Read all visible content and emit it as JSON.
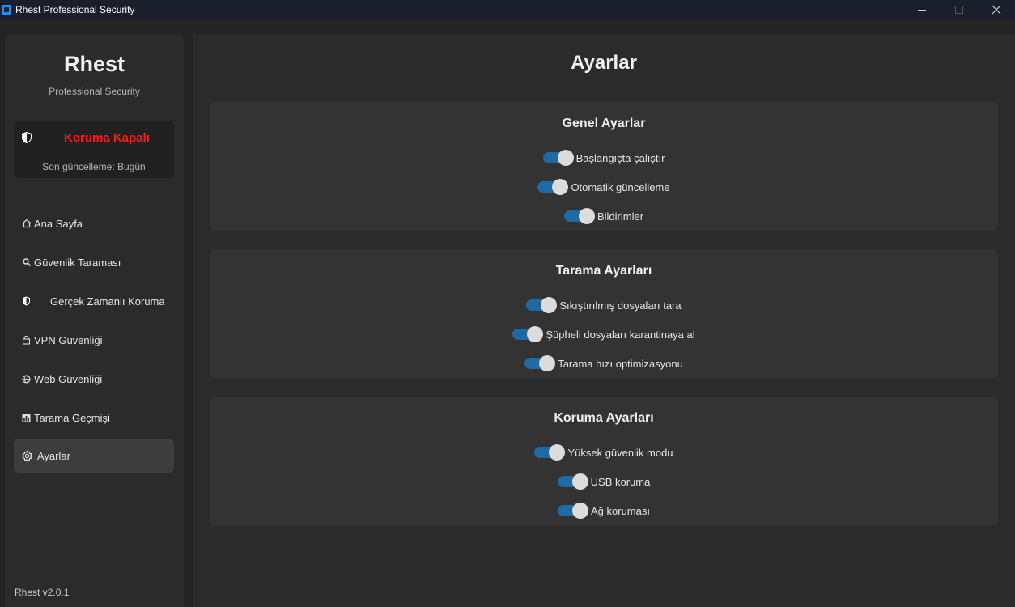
{
  "window": {
    "title": "Rhest Professional Security",
    "controls": [
      "minimize",
      "maximize",
      "close"
    ]
  },
  "sidebar": {
    "brand": "Rhest",
    "subtitle": "Professional Security",
    "status": {
      "label": "Koruma Kapalı",
      "label_color": "#ff1a1a",
      "last_update": "Son güncelleme: Bugün",
      "icon": "shield-icon"
    },
    "items": [
      {
        "label": "Ana Sayfa",
        "icon": "house-icon"
      },
      {
        "label": "Güvenlik Taraması",
        "icon": "magnifier-icon"
      },
      {
        "label": "Gerçek Zamanlı Koruma",
        "icon": "shield-icon"
      },
      {
        "label": "VPN Güvenliği",
        "icon": "lock-icon"
      },
      {
        "label": "Web Güvenliği",
        "icon": "globe-icon"
      },
      {
        "label": "Tarama Geçmişi",
        "icon": "chart-icon"
      },
      {
        "label": "Ayarlar",
        "icon": "gear-icon",
        "active": true
      }
    ],
    "version": "Rhest v2.0.1"
  },
  "main": {
    "title": "Ayarlar",
    "sections": [
      {
        "title": "Genel Ayarlar",
        "settings": [
          {
            "label": "Başlangıçta çalıştır",
            "enabled": true
          },
          {
            "label": "Otomatik güncelleme",
            "enabled": true
          },
          {
            "label": "Bildirimler",
            "enabled": true
          }
        ]
      },
      {
        "title": "Tarama Ayarları",
        "settings": [
          {
            "label": "Sıkıştırılmış dosyaları tara",
            "enabled": true
          },
          {
            "label": "Şüpheli dosyaları karantinaya al",
            "enabled": true
          },
          {
            "label": "Tarama hızı optimizasyonu",
            "enabled": true
          }
        ]
      },
      {
        "title": "Koruma Ayarları",
        "settings": [
          {
            "label": "Yüksek güvenlik modu",
            "enabled": true
          },
          {
            "label": "USB koruma",
            "enabled": true
          },
          {
            "label": "Ağ koruması",
            "enabled": true
          }
        ]
      }
    ]
  },
  "colors": {
    "accent": "#1f6aa5",
    "background": "#242424",
    "panel": "#2b2b2b",
    "section": "#333333",
    "danger": "#ff1a1a"
  }
}
